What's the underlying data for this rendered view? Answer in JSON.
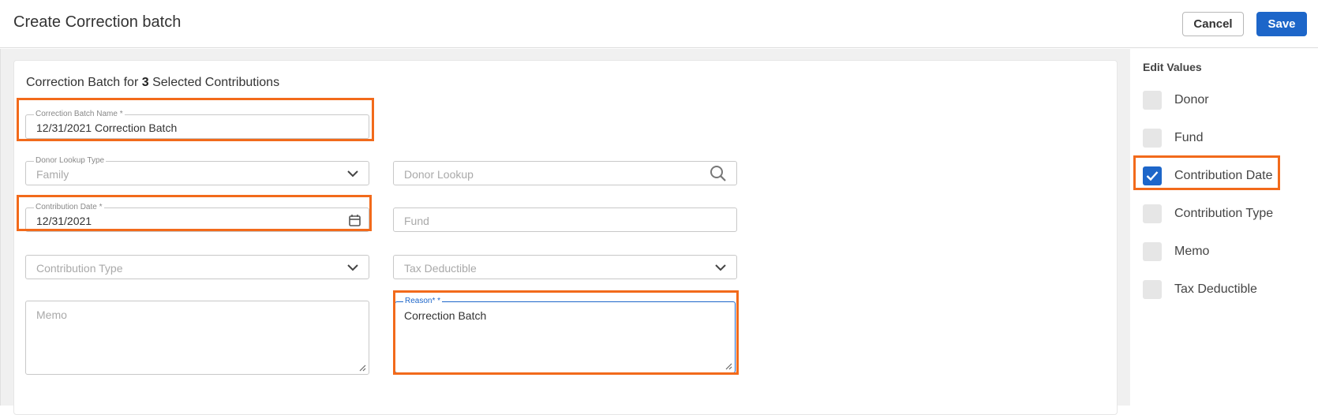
{
  "header": {
    "title": "Create Correction batch",
    "cancel_label": "Cancel",
    "save_label": "Save"
  },
  "form": {
    "heading_prefix": "Correction Batch for",
    "selected_count": "3",
    "heading_suffix": "Selected Contributions",
    "batch_name": {
      "label": "Correction Batch Name *",
      "value": "12/31/2021 Correction Batch"
    },
    "donor_lookup_type": {
      "label": "Donor Lookup Type",
      "value": "Family"
    },
    "donor_lookup": {
      "placeholder": "Donor Lookup"
    },
    "contribution_date": {
      "label": "Contribution Date *",
      "value": "12/31/2021"
    },
    "fund": {
      "placeholder": "Fund"
    },
    "contribution_type": {
      "placeholder": "Contribution Type"
    },
    "tax_deductible": {
      "placeholder": "Tax Deductible"
    },
    "memo": {
      "placeholder": "Memo"
    },
    "reason": {
      "label": "Reason* *",
      "value": "Correction Batch"
    }
  },
  "sidebar": {
    "heading": "Edit Values",
    "items": [
      {
        "label": "Donor",
        "checked": false
      },
      {
        "label": "Fund",
        "checked": false
      },
      {
        "label": "Contribution Date",
        "checked": true
      },
      {
        "label": "Contribution Type",
        "checked": false
      },
      {
        "label": "Memo",
        "checked": false
      },
      {
        "label": "Tax Deductible",
        "checked": false
      }
    ]
  },
  "colors": {
    "accent": "#1d66c9",
    "highlight": "#f26a1b"
  }
}
